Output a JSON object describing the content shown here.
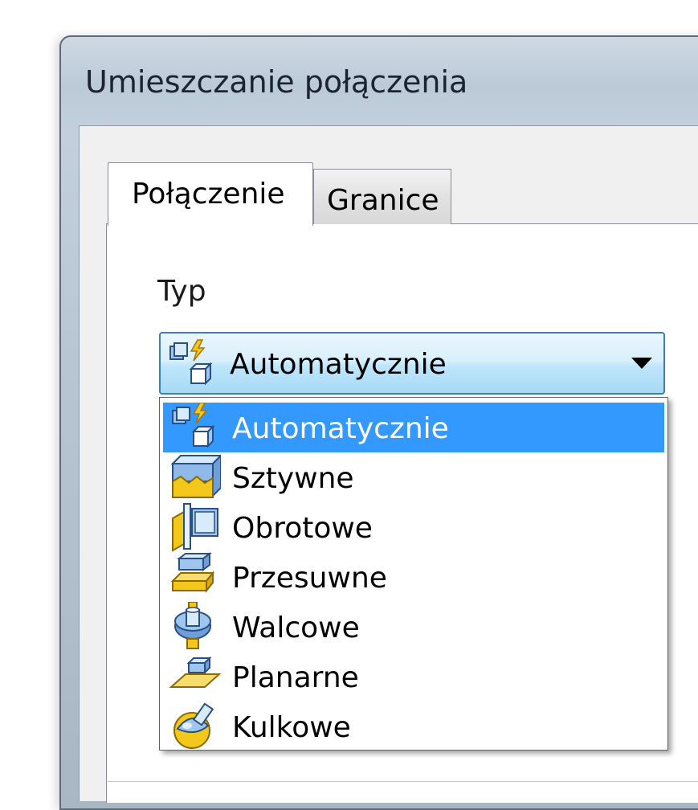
{
  "window": {
    "title": "Umieszczanie połączenia"
  },
  "tabs": [
    {
      "label": "Połączenie",
      "active": true
    },
    {
      "label": "Granice",
      "active": false
    }
  ],
  "type_section": {
    "label": "Typ",
    "selected_value": "Automatycznie",
    "selected_icon": "automatic-joint-icon"
  },
  "dropdown": {
    "items": [
      {
        "label": "Automatycznie",
        "icon": "automatic-joint-icon",
        "highlighted": true
      },
      {
        "label": "Sztywne",
        "icon": "rigid-joint-icon",
        "highlighted": false
      },
      {
        "label": "Obrotowe",
        "icon": "rotational-joint-icon",
        "highlighted": false
      },
      {
        "label": "Przesuwne",
        "icon": "slider-joint-icon",
        "highlighted": false
      },
      {
        "label": "Walcowe",
        "icon": "cylindrical-joint-icon",
        "highlighted": false
      },
      {
        "label": "Planarne",
        "icon": "planar-joint-icon",
        "highlighted": false
      },
      {
        "label": "Kulkowe",
        "icon": "ball-joint-icon",
        "highlighted": false
      }
    ]
  },
  "colors": {
    "highlight": "#3399ff",
    "combo_border": "#3c7fb1",
    "icon_yellow": "#f4c81a",
    "icon_blue": "#4a7fc8"
  }
}
